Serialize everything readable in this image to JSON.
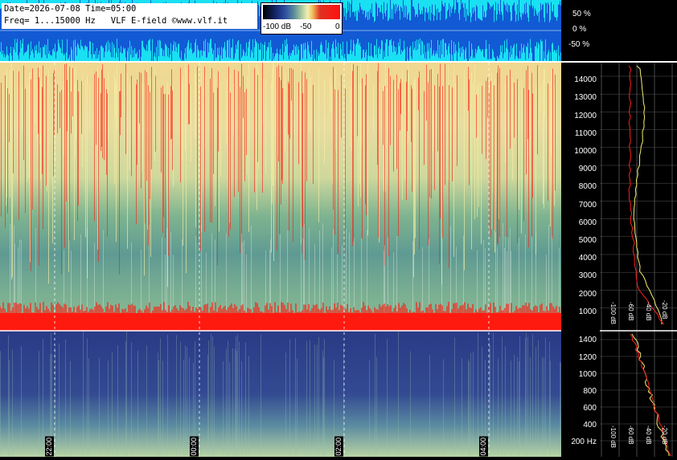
{
  "header": {
    "date_line": "Date=2026-07-08 Time=05:00",
    "freq_line": "Freq= 1...15000 Hz   VLF E-field ©www.vlf.it"
  },
  "scale": {
    "labels": [
      "-100 dB",
      "-50",
      "0"
    ]
  },
  "amplitude_axis": [
    "50 %",
    "0 %",
    "-50 %"
  ],
  "freq_axis_upper": [
    "14000",
    "13000",
    "12000",
    "11000",
    "10000",
    "9000",
    "8000",
    "7000",
    "6000",
    "5000",
    "4000",
    "3000",
    "2000",
    "1000"
  ],
  "freq_axis_lower": [
    "1400",
    "1200",
    "1000",
    "800",
    "600",
    "400",
    "200 Hz"
  ],
  "time_labels": [
    "22:00",
    "00:00",
    "02:00",
    "04:00"
  ],
  "profile_db_upper": [
    "-100 dB",
    "-60 dB",
    "-40 dB",
    "-20 dB"
  ],
  "profile_db_lower": [
    "-100 dB",
    "-60 dB",
    "-40 dB",
    "-20 dB"
  ],
  "colors": {
    "wave_bg": "#19e0f2",
    "wave_fg": "#1020c8",
    "hot": "#ff1a10",
    "green": "#6fa88a",
    "blue": "#2c3c8c"
  }
}
